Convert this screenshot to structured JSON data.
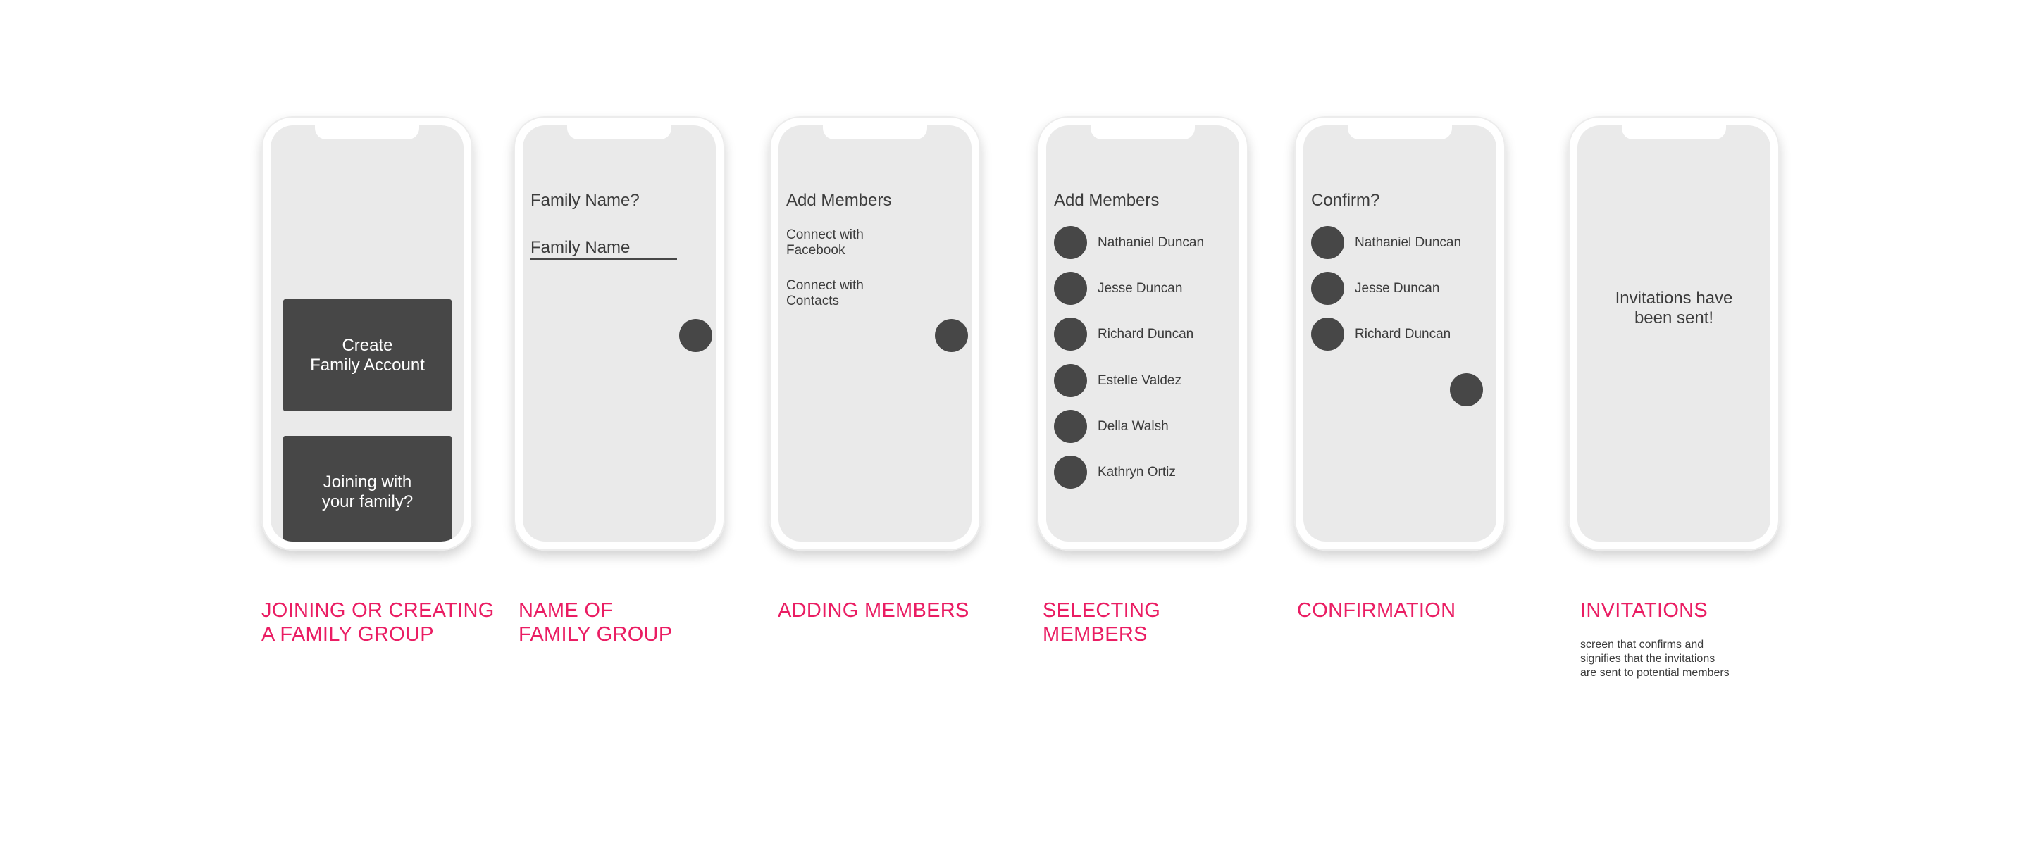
{
  "screens": {
    "join": {
      "create_button": "Create\nFamily Account",
      "join_button": "Joining with\nyour family?"
    },
    "name": {
      "heading": "Family Name?",
      "field_value": "Family Name"
    },
    "add": {
      "heading": "Add Members",
      "facebook": "Connect with\nFacebook",
      "contacts": "Connect with\nContacts"
    },
    "select": {
      "heading": "Add Members",
      "members": [
        "Nathaniel Duncan",
        "Jesse Duncan",
        "Richard Duncan",
        "Estelle Valdez",
        "Della Walsh",
        "Kathryn Ortiz"
      ]
    },
    "confirm": {
      "heading": "Confirm?",
      "members": [
        "Nathaniel Duncan",
        "Jesse Duncan",
        "Richard Duncan"
      ]
    },
    "invite": {
      "message": "Invitations have\nbeen sent!"
    }
  },
  "captions": {
    "join": "JOINING OR CREATING\nA FAMILY GROUP",
    "name": "NAME OF\nFAMILY GROUP",
    "add": "ADDING MEMBERS",
    "select": "SELECTING\nMEMBERS",
    "confirm": "CONFIRMATION",
    "invite": "INVITATIONS",
    "invite_note": "screen that confirms and\nsignifies that the invitations\nare sent to potential members"
  },
  "colors": {
    "caption": "#ea1d63",
    "dark": "#474747",
    "screen": "#eaeaea"
  },
  "icons": {
    "fab": "circle-next-button",
    "avatar": "avatar-circle"
  }
}
